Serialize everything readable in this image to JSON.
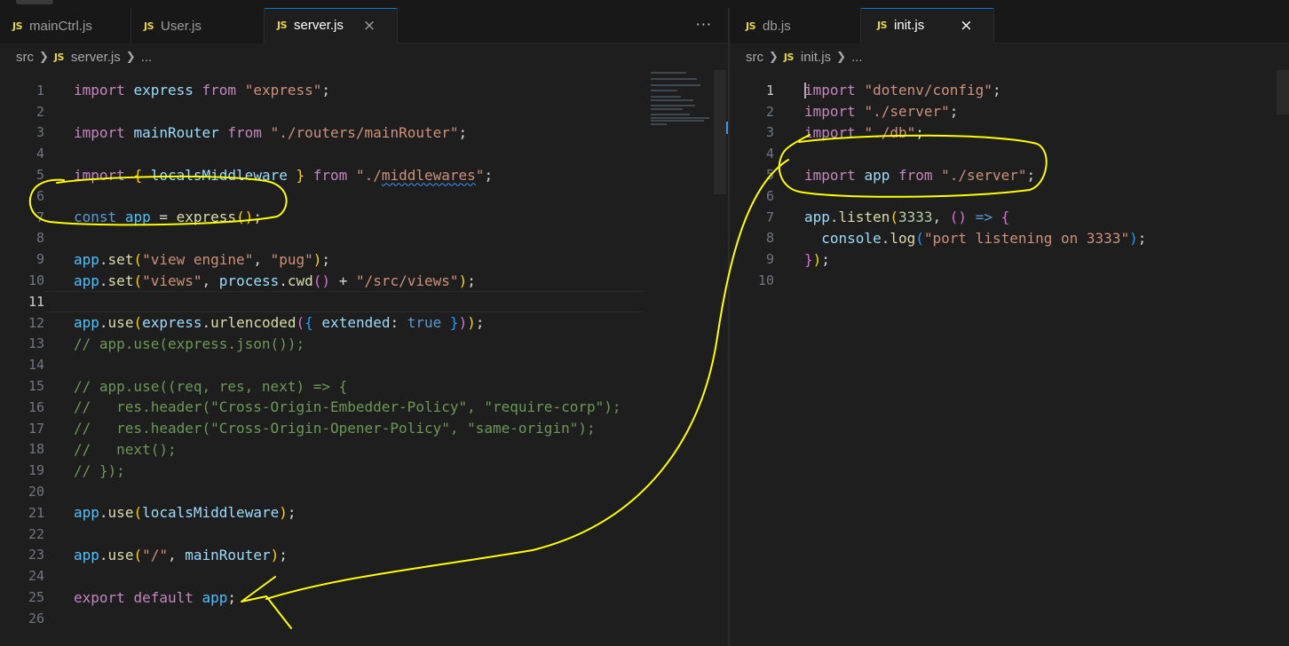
{
  "left_pane": {
    "tabs": [
      {
        "label": "mainCtrl.js",
        "icon": "JS"
      },
      {
        "label": "User.js",
        "icon": "JS"
      },
      {
        "label": "server.js",
        "icon": "JS",
        "close": "×"
      }
    ],
    "more": "···",
    "breadcrumb": {
      "folder": "src",
      "file": "server.js",
      "rest": "..."
    },
    "line_numbers": [
      "1",
      "2",
      "3",
      "4",
      "5",
      "6",
      "7",
      "8",
      "9",
      "10",
      "11",
      "12",
      "13",
      "14",
      "15",
      "16",
      "17",
      "18",
      "19",
      "20",
      "21",
      "22",
      "23",
      "24",
      "25",
      "26"
    ]
  },
  "right_pane": {
    "tabs": [
      {
        "label": "db.js",
        "icon": "JS"
      },
      {
        "label": "init.js",
        "icon": "JS",
        "close": "×"
      }
    ],
    "breadcrumb": {
      "folder": "src",
      "file": "init.js",
      "rest": "..."
    },
    "line_numbers": [
      "1",
      "2",
      "3",
      "4",
      "5",
      "6",
      "7",
      "8",
      "9",
      "10"
    ]
  },
  "server_js": {
    "l1": [
      "import",
      " ",
      "express",
      " ",
      "from",
      " ",
      "\"express\"",
      ";"
    ],
    "l3": [
      "import",
      " ",
      "mainRouter",
      " ",
      "from",
      " ",
      "\"./routers/mainRouter\"",
      ";"
    ],
    "l5": [
      "import",
      " ",
      "{",
      " ",
      "localsMiddleware",
      " ",
      "}",
      " ",
      "from",
      " ",
      "\"./",
      "middlewares",
      "\"",
      ";"
    ],
    "l7": [
      "const",
      " ",
      "app",
      " = ",
      "express",
      "(",
      ")",
      ";"
    ],
    "l9": [
      "app",
      ".",
      "set",
      "(",
      "\"view engine\"",
      ", ",
      "\"pug\"",
      ")",
      ";"
    ],
    "l10": [
      "app",
      ".",
      "set",
      "(",
      "\"views\"",
      ", ",
      "process",
      ".",
      "cwd",
      "(",
      ")",
      " + ",
      "\"/src/views\"",
      ")",
      ";"
    ],
    "l12": [
      "app",
      ".",
      "use",
      "(",
      "express",
      ".",
      "urlencoded",
      "(",
      "{",
      " ",
      "extended",
      ": ",
      "true",
      " ",
      "}",
      ")",
      ")",
      ";"
    ],
    "l13": "// app.use(express.json());",
    "l15": "// app.use((req, res, next) => {",
    "l16": "//   res.header(\"Cross-Origin-Embedder-Policy\", \"require-corp\");",
    "l17": "//   res.header(\"Cross-Origin-Opener-Policy\", \"same-origin\");",
    "l18": "//   next();",
    "l19": "// });",
    "l21": [
      "app",
      ".",
      "use",
      "(",
      "localsMiddleware",
      ")",
      ";"
    ],
    "l23": [
      "app",
      ".",
      "use",
      "(",
      "\"/\"",
      ", ",
      "mainRouter",
      ")",
      ";"
    ],
    "l25": [
      "export",
      " ",
      "default",
      " ",
      "app",
      ";"
    ]
  },
  "init_js": {
    "l1": [
      "import",
      " ",
      "\"dotenv/config\"",
      ";"
    ],
    "l2": [
      "import",
      " ",
      "\"./server\"",
      ";"
    ],
    "l3": [
      "import",
      " ",
      "\"./db\"",
      ";"
    ],
    "l5": [
      "import",
      " ",
      "app",
      " ",
      "from",
      " ",
      "\"./server\"",
      ";"
    ],
    "l7": [
      "app",
      ".",
      "listen",
      "(",
      "3333",
      ", ",
      "(",
      ")",
      " ",
      "=>",
      " ",
      "{"
    ],
    "l8": [
      "  ",
      "console",
      ".",
      "log",
      "(",
      "\"port listening on 3333\"",
      ")",
      ";"
    ],
    "l9": [
      "}",
      ")",
      ";"
    ]
  },
  "colors": {
    "annotation": "#ffff00",
    "keyword": "#c586c0",
    "string": "#ce9178",
    "function": "#dcdcaa",
    "comment": "#6a9955"
  }
}
